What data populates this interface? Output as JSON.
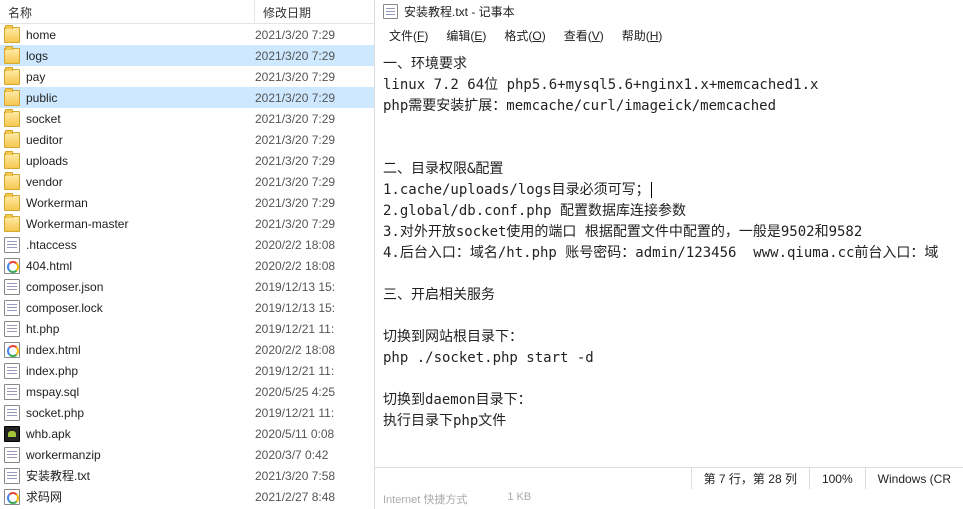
{
  "explorer": {
    "columns": {
      "name": "名称",
      "date": "修改日期"
    },
    "rows": [
      {
        "type": "folder",
        "name": "home",
        "date": "2021/3/20 7:29"
      },
      {
        "type": "folder",
        "name": "logs",
        "date": "2021/3/20 7:29",
        "sel": true
      },
      {
        "type": "folder",
        "name": "pay",
        "date": "2021/3/20 7:29"
      },
      {
        "type": "folder",
        "name": "public",
        "date": "2021/3/20 7:29",
        "sel": true
      },
      {
        "type": "folder",
        "name": "socket",
        "date": "2021/3/20 7:29"
      },
      {
        "type": "folder",
        "name": "ueditor",
        "date": "2021/3/20 7:29"
      },
      {
        "type": "folder",
        "name": "uploads",
        "date": "2021/3/20 7:29"
      },
      {
        "type": "folder",
        "name": "vendor",
        "date": "2021/3/20 7:29"
      },
      {
        "type": "folder",
        "name": "Workerman",
        "date": "2021/3/20 7:29"
      },
      {
        "type": "folder",
        "name": "Workerman-master",
        "date": "2021/3/20 7:29"
      },
      {
        "type": "txt",
        "name": ".htaccess",
        "date": "2020/2/2 18:08"
      },
      {
        "type": "chrome",
        "name": "404.html",
        "date": "2020/2/2 18:08"
      },
      {
        "type": "txt",
        "name": "composer.json",
        "date": "2019/12/13 15:"
      },
      {
        "type": "txt",
        "name": "composer.lock",
        "date": "2019/12/13 15:"
      },
      {
        "type": "txt",
        "name": "ht.php",
        "date": "2019/12/21 11:"
      },
      {
        "type": "chrome",
        "name": "index.html",
        "date": "2020/2/2 18:08"
      },
      {
        "type": "txt",
        "name": "index.php",
        "date": "2019/12/21 11:"
      },
      {
        "type": "txt",
        "name": "mspay.sql",
        "date": "2020/5/25 4:25"
      },
      {
        "type": "txt",
        "name": "socket.php",
        "date": "2019/12/21 11:"
      },
      {
        "type": "apk",
        "name": "whb.apk",
        "date": "2020/5/11 0:08"
      },
      {
        "type": "txt",
        "name": "workermanzip",
        "date": "2020/3/7 0:42"
      },
      {
        "type": "txt",
        "name": "安装教程.txt",
        "date": "2021/3/20 7:58"
      },
      {
        "type": "chrome",
        "name": "求码网",
        "date": "2021/2/27 8:48"
      }
    ]
  },
  "notepad": {
    "title": "安装教程.txt - 记事本",
    "menu": {
      "file": "文件(F)",
      "edit": "编辑(E)",
      "format": "格式(O)",
      "view": "查看(V)",
      "help": "帮助(H)"
    },
    "content_lines": [
      "一、环境要求",
      "linux 7.2 64位 php5.6+mysql5.6+nginx1.x+memcached1.x",
      "php需要安装扩展：memcache/curl/imageick/memcached",
      "",
      "",
      "二、目录权限&配置",
      "1.cache/uploads/logs目录必须可写；",
      "2.global/db.conf.php 配置数据库连接参数",
      "3.对外开放socket使用的端口 根据配置文件中配置的，一般是9502和9582",
      "4.后台入口：域名/ht.php 账号密码：admin/123456  www.qiuma.cc前台入口：域",
      "",
      "三、开启相关服务",
      "",
      "切换到网站根目录下：",
      "php ./socket.php start -d",
      "",
      "切换到daemon目录下：",
      "执行目录下php文件"
    ],
    "caret_line_index": 6,
    "status": {
      "pos": "第 7 行，第 28 列",
      "zoom": "100%",
      "enc": "Windows (CR"
    },
    "bottom": {
      "a": "Internet 快捷方式",
      "b": "1 KB"
    }
  }
}
